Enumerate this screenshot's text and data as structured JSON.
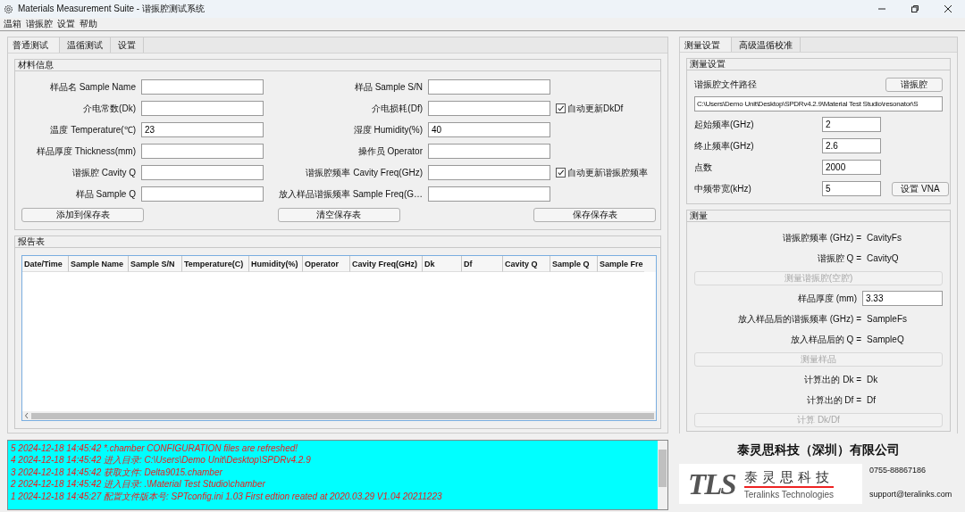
{
  "window": {
    "title": "Materials Measurement Suite - 谐振腔测试系统"
  },
  "menu": [
    "温箱",
    "谐振腔",
    "设置",
    "帮助"
  ],
  "left_tabs": [
    {
      "label": "普通测试",
      "selected": true
    },
    {
      "label": "温循测试",
      "selected": false
    },
    {
      "label": "设置",
      "selected": false
    }
  ],
  "material_info": {
    "title": "材料信息",
    "rows": [
      {
        "left": {
          "label": "样品名 Sample Name"
        },
        "right": {
          "label": "样品 Sample S/N"
        }
      },
      {
        "left": {
          "label": "介电常数(Dk)"
        },
        "right": {
          "label": "介电损耗(Df)"
        },
        "checkbox": {
          "label": "自动更新DkDf",
          "checked": true
        }
      },
      {
        "left": {
          "label": "温度 Temperature(℃)",
          "value": "23"
        },
        "right": {
          "label": "湿度 Humidity(%)",
          "value": "40"
        }
      },
      {
        "left": {
          "label": "样品厚度 Thickness(mm)"
        },
        "right": {
          "label": "操作员 Operator"
        }
      },
      {
        "left": {
          "label": "谐振腔 Cavity Q"
        },
        "right": {
          "label": "谐振腔频率 Cavity Freq(GHz)"
        },
        "checkbox": {
          "label": "自动更新谐振腔频率",
          "checked": true
        }
      },
      {
        "left": {
          "label": "样品 Sample Q"
        },
        "right": {
          "label": "放入样品谐振频率 Sample Freq(G…"
        }
      }
    ],
    "buttons": [
      "添加到保存表",
      "清空保存表",
      "保存保存表"
    ]
  },
  "report": {
    "title": "报告表",
    "columns": [
      "Date/Time",
      "Sample Name",
      "Sample S/N",
      "Temperature(C)",
      "Humidity(%)",
      "Operator",
      "Cavity Freq(GHz)",
      "Dk",
      "Df",
      "Cavity Q",
      "Sample Q",
      "Sample Fre"
    ]
  },
  "log": [
    "5 2024-12-18 14:45:42 *.chamber CONFIGURATION files are refreshed!",
    "4 2024-12-18 14:45:42 进入目录: C:\\Users\\Demo Unit\\Desktop\\SPDRv4.2.9",
    "3 2024-12-18 14:45:42 获取文件: Delta9015.chamber",
    "2 2024-12-18 14:45:42 进入目录: .\\Material Test Studio\\chamber",
    "1 2024-12-18 14:45:27 配置文件版本号: SPTconfig.ini 1.03 First edtion reated at 2020.03.29 V1.04 20211223"
  ],
  "right_tabs": [
    {
      "label": "测量设置",
      "selected": true
    },
    {
      "label": "高级温循校准",
      "selected": false
    }
  ],
  "measure_settings": {
    "title": "测量设置",
    "path_label": "谐振腔文件路径",
    "path_button": "谐振腔",
    "path_value": "C:\\Users\\Demo Unit\\Desktop\\SPDRv4.2.9\\Material Test Studio\\resonator\\S",
    "fields": [
      {
        "label": "起始频率(GHz)",
        "value": "2"
      },
      {
        "label": "终止频率(GHz)",
        "value": "2.6"
      },
      {
        "label": "点数",
        "value": "2000"
      },
      {
        "label": "中频带宽(kHz)",
        "value": "5"
      }
    ],
    "vna_button": "设置 VNA"
  },
  "measure": {
    "title": "测量",
    "items": [
      {
        "kind": "readout",
        "label": "谐振腔频率 (GHz) =",
        "value": "CavityFs"
      },
      {
        "kind": "readout",
        "label": "谐振腔 Q =",
        "value": "CavityQ"
      },
      {
        "kind": "button",
        "label": "测量谐振腔(空腔)",
        "disabled": true
      },
      {
        "kind": "input",
        "label": "样品厚度 (mm)",
        "value": "3.33"
      },
      {
        "kind": "readout",
        "label": "放入样品后的谐振频率 (GHz) =",
        "value": "SampleFs"
      },
      {
        "kind": "readout",
        "label": "放入样品后的 Q =",
        "value": "SampleQ"
      },
      {
        "kind": "button",
        "label": "测量样品",
        "disabled": true
      },
      {
        "kind": "readout",
        "label": "计算出的 Dk =",
        "value": "Dk"
      },
      {
        "kind": "readout",
        "label": "计算出的  Df =",
        "value": "Df"
      },
      {
        "kind": "button",
        "label": "计算 Dk/Df",
        "disabled": true
      }
    ]
  },
  "company": {
    "name": "泰灵思科技（深圳）有限公司",
    "logo_letters": "TLS",
    "logo_cn": "泰灵思科技",
    "logo_en": "Teralinks Technologies",
    "phone": "0755-88867186",
    "email": "support@teralinks.com"
  }
}
